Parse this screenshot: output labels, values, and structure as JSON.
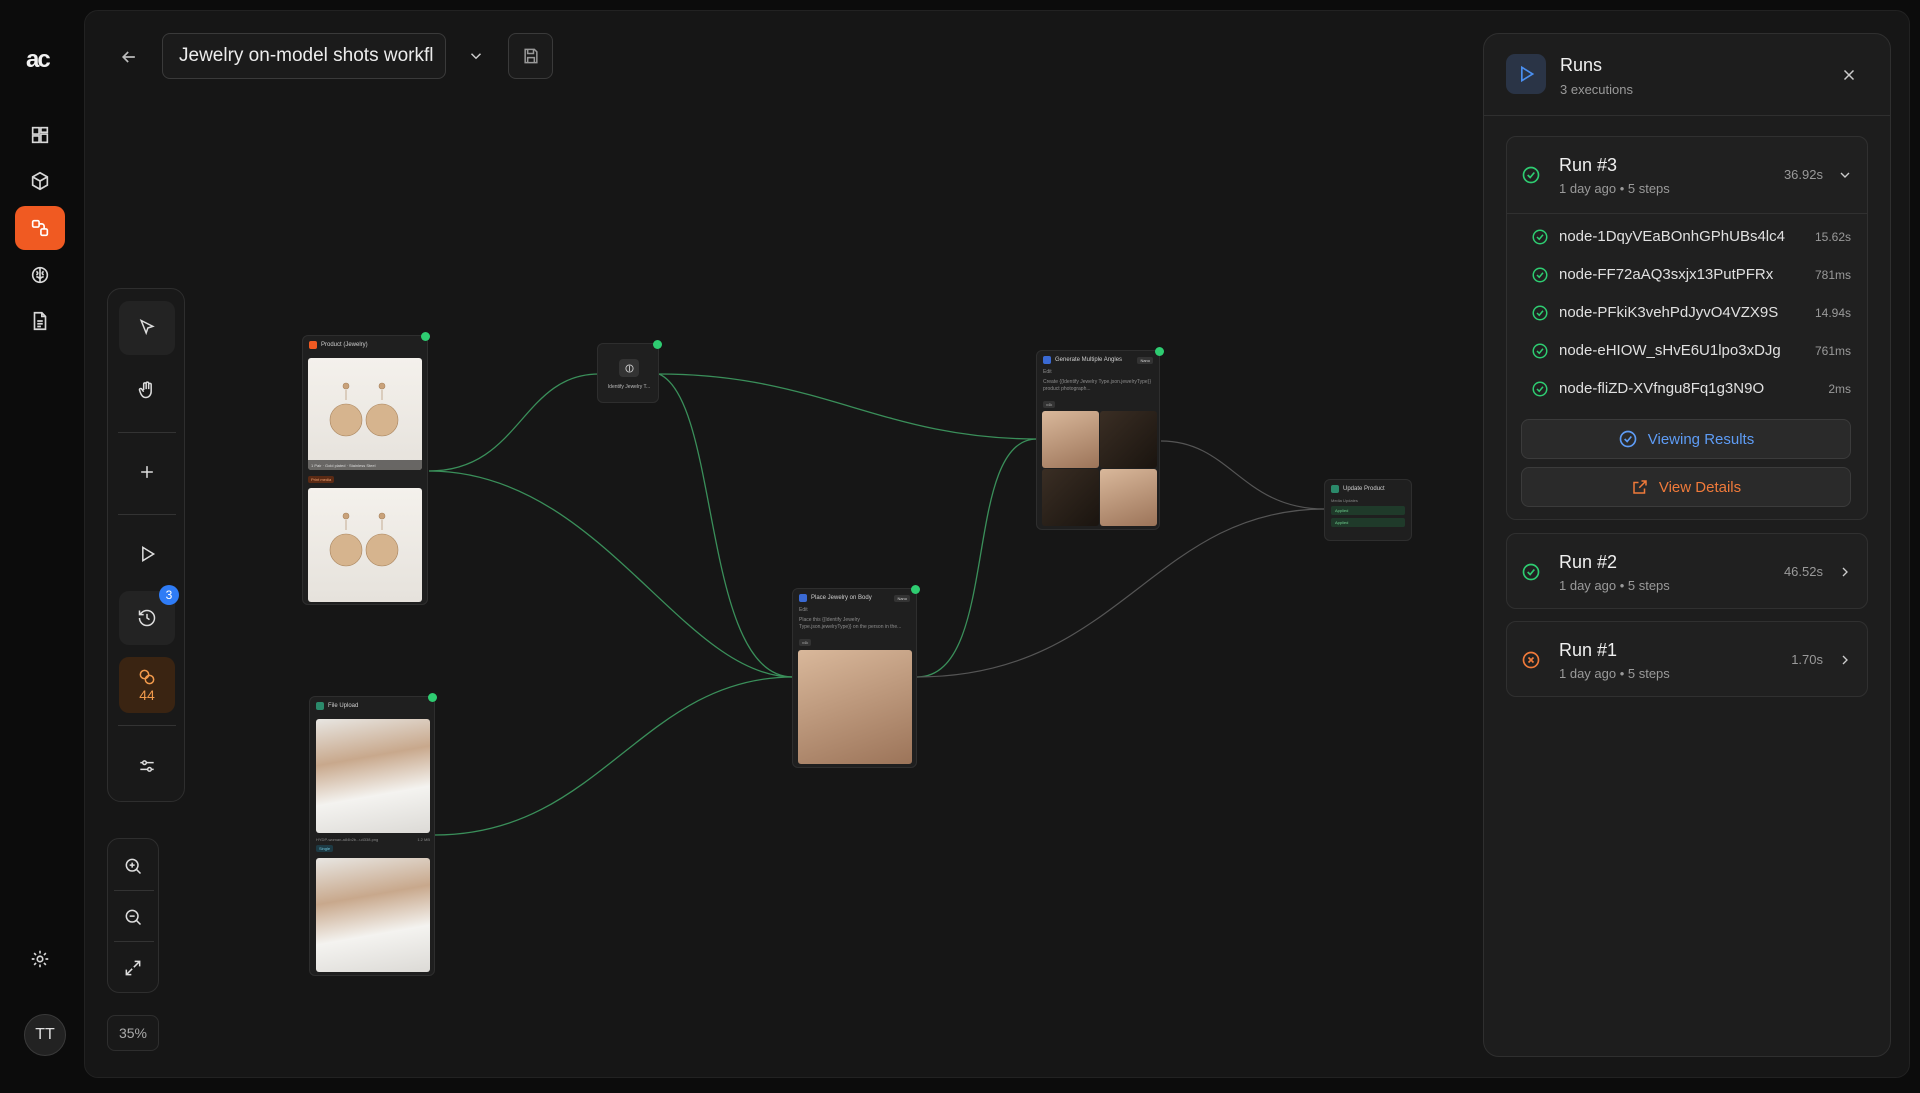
{
  "app": {
    "logo": "ac"
  },
  "rail": {
    "items": [
      {
        "icon": "dashboard-icon"
      },
      {
        "icon": "box-icon"
      },
      {
        "icon": "workflow-icon",
        "active": true
      },
      {
        "icon": "brain-icon"
      },
      {
        "icon": "document-icon"
      }
    ],
    "settings_icon": "gear-icon",
    "avatar_initials": "TT"
  },
  "header": {
    "workflow_title": "Jewelry on-model shots workfl"
  },
  "toolbar": {
    "history_badge": "3",
    "credits": "44"
  },
  "zoom": {
    "level": "35%"
  },
  "nodes": {
    "product": {
      "title": "Product (Jewelry)",
      "img_caption": "1 Pair · Gold plated · Stainless Steel",
      "tag": "Print media"
    },
    "identify": {
      "title": "Identify Jewelry T..."
    },
    "angles": {
      "title": "Generate Multiple Angles",
      "badge": "Nano",
      "edit": "Edit",
      "text": "Create {{Identify Jewelry Type.json.jewelryType}} product photograph...",
      "count": "x4k"
    },
    "place": {
      "title": "Place Jewelry on Body",
      "badge": "Nano",
      "edit": "Edit",
      "text": "Place this {{Identify Jewelry Type.json.jewelryType}} on the person in the...",
      "count": "x4k"
    },
    "upload": {
      "title": "File Upload",
      "filename": "HYDP-woman-a84b2b...u4338.png",
      "size": "1.2 MB",
      "tag": "Single"
    },
    "update": {
      "title": "Update Product",
      "label": "Media Updates",
      "row1": "Applied",
      "row2": "Applied"
    }
  },
  "runs": {
    "title": "Runs",
    "subtitle": "3 executions",
    "items": [
      {
        "title": "Run #3",
        "meta": "1 day ago • 5 steps",
        "duration": "36.92s",
        "status": "success",
        "expanded": true,
        "steps": [
          {
            "name": "node-1DqyVEaBOnhGPhUBs4lc4",
            "duration": "15.62s"
          },
          {
            "name": "node-FF72aAQ3sxjx13PutPFRx",
            "duration": "781ms"
          },
          {
            "name": "node-PFkiK3vehPdJyvO4VZX9S",
            "duration": "14.94s"
          },
          {
            "name": "node-eHIOW_sHvE6U1lpo3xDJg",
            "duration": "761ms"
          },
          {
            "name": "node-fliZD-XVfngu8Fq1g3N9O",
            "duration": "2ms"
          }
        ],
        "viewing_label": "Viewing Results",
        "details_label": "View Details"
      },
      {
        "title": "Run #2",
        "meta": "1 day ago • 5 steps",
        "duration": "46.52s",
        "status": "success"
      },
      {
        "title": "Run #1",
        "meta": "1 day ago • 5 steps",
        "duration": "1.70s",
        "status": "error"
      }
    ]
  },
  "colors": {
    "accent": "#f05a22",
    "success": "#2ecc71",
    "info": "#4a8ff0",
    "warning": "#f07a3a",
    "edge": "#3a8f5a"
  }
}
